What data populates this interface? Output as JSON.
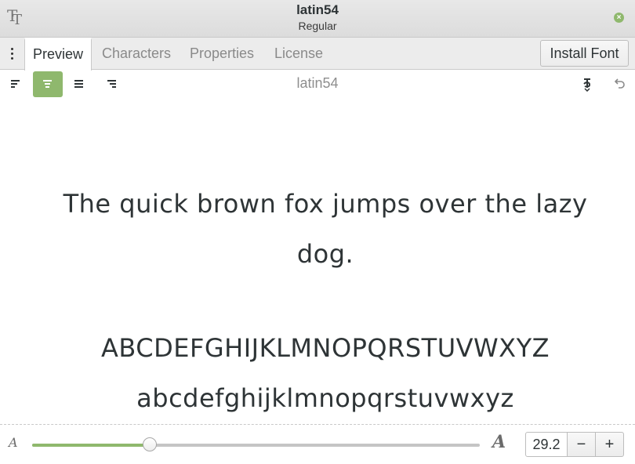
{
  "window": {
    "title": "latin54",
    "subtitle": "Regular",
    "app_icon_glyphs": [
      "T",
      "T"
    ],
    "close_glyph": "×"
  },
  "tabs": [
    {
      "label": "Preview",
      "active": true
    },
    {
      "label": "Characters",
      "active": false
    },
    {
      "label": "Properties",
      "active": false
    },
    {
      "label": "License",
      "active": false
    }
  ],
  "tabbar": {
    "install_label": "Install Font"
  },
  "toolbar": {
    "font_name": "latin54",
    "alignment_options": [
      "align-left",
      "align-center",
      "justify",
      "align-right"
    ],
    "selected_alignment": "align-center",
    "icons": [
      "language-icon",
      "undo-icon"
    ]
  },
  "preview": {
    "sentence": "The quick brown fox jumps over the lazy dog.",
    "uppercase": "ABCDEFGHIJKLMNOPQRSTUVWXYZ",
    "lowercase": "abcdefghijklmnopqrstuvwxyz"
  },
  "bottombar": {
    "size_value": "29.2",
    "slider_level": 0.262,
    "small_a": "A",
    "large_a": "A",
    "minus_label": "−",
    "plus_label": "+"
  },
  "colors": {
    "accent": "#8fb86d",
    "text": "#2e3436",
    "inactive_tab": "#8a8a8a"
  }
}
